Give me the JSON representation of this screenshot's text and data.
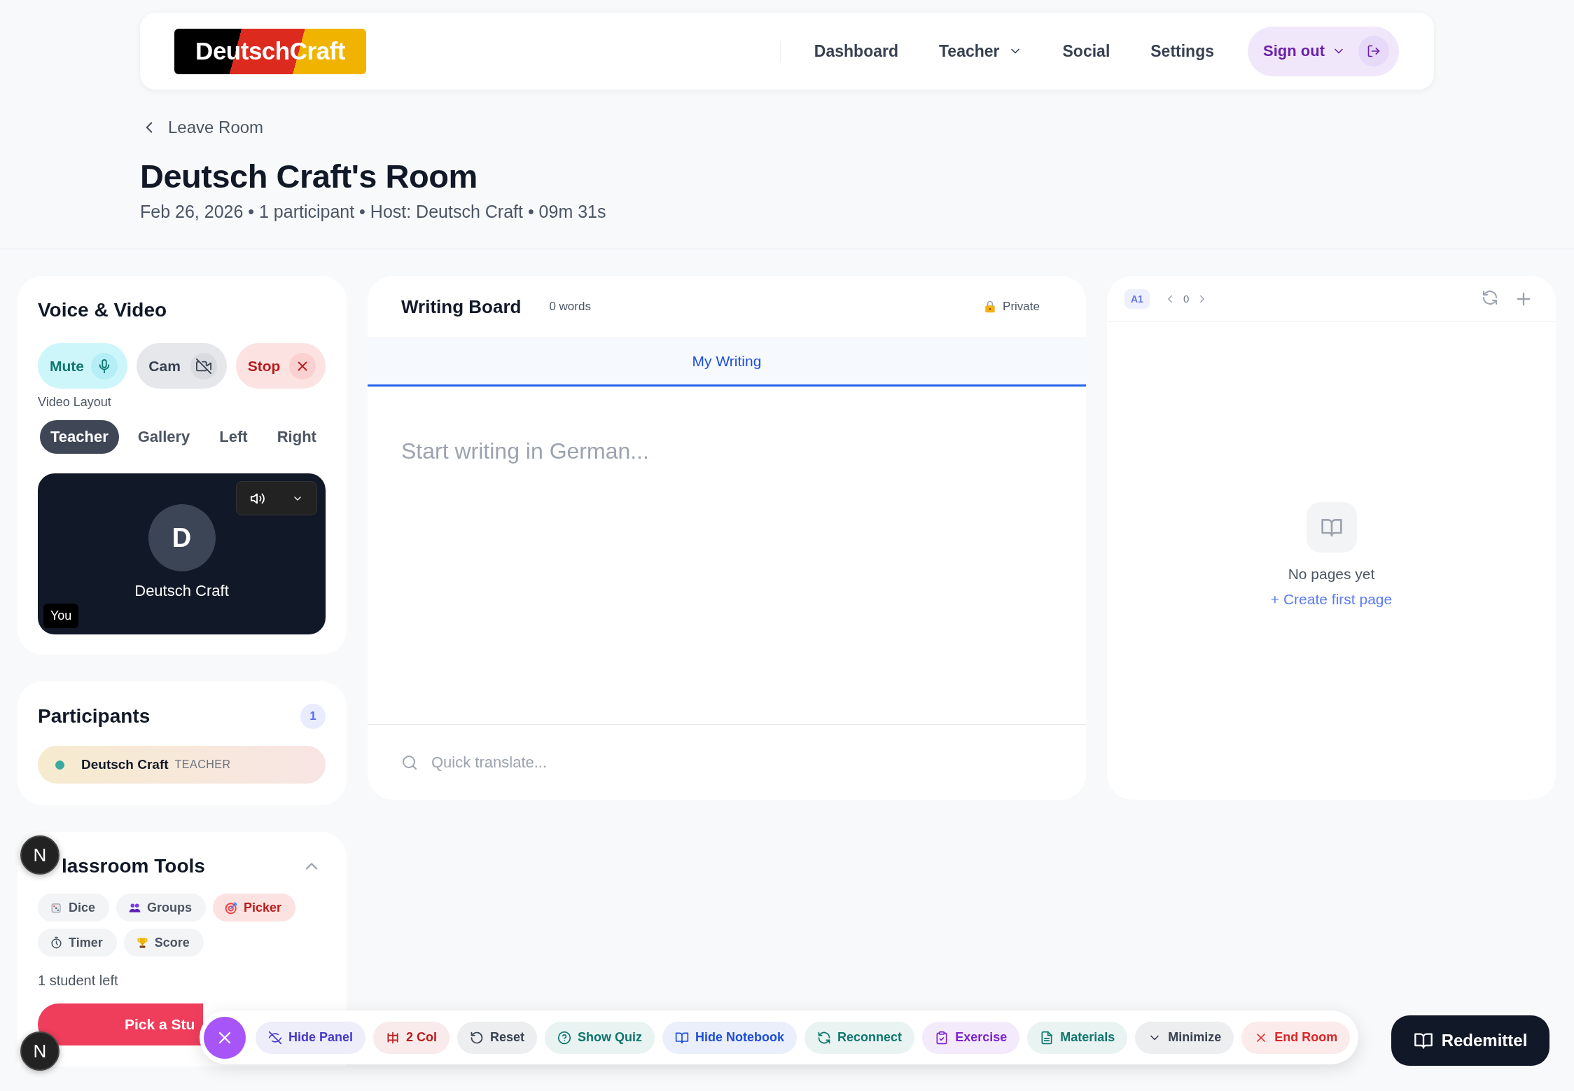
{
  "header": {
    "logo": "DeutschCraft",
    "nav": [
      {
        "label": "Dashboard",
        "dropdown": false
      },
      {
        "label": "Teacher",
        "dropdown": true
      },
      {
        "label": "Social",
        "dropdown": false
      },
      {
        "label": "Settings",
        "dropdown": false
      }
    ],
    "account": {
      "label": "Sign out"
    }
  },
  "room": {
    "back": "Leave Room",
    "title": "Deutsch Craft's Room",
    "meta": "Feb 26, 2026 • 1 participant • Host: Deutsch Craft • 09m 31s"
  },
  "voice_video": {
    "title": "Voice & Video",
    "controls": [
      {
        "kind": "mic",
        "label": "Mute",
        "color": "#0f766e"
      },
      {
        "kind": "camoff",
        "label": "Cam",
        "color": "#374151"
      },
      {
        "kind": "stop",
        "label": "Stop",
        "color": "#b91c1c"
      }
    ],
    "layout_label": "Video Layout",
    "layouts": [
      {
        "label": "Teacher",
        "selected": true
      },
      {
        "label": "Gallery",
        "selected": false
      },
      {
        "label": "Left",
        "selected": false
      },
      {
        "label": "Right",
        "selected": false
      }
    ],
    "tile": {
      "initial": "D",
      "name": "Deutsch Craft",
      "tag": "You"
    }
  },
  "participants": {
    "title": "Participants",
    "count": "1",
    "items": [
      {
        "name": "Deutsch Craft",
        "role": "TEACHER",
        "color": "#3aa99f"
      }
    ]
  },
  "classroom_tools": {
    "title": "lassroom Tools",
    "expanded": true,
    "tools": [
      {
        "label": "Dice",
        "selected": false
      },
      {
        "label": "Groups",
        "selected": false
      },
      {
        "label": "Picker",
        "selected": true
      },
      {
        "label": "Timer",
        "selected": false
      },
      {
        "label": "Score",
        "selected": false
      }
    ],
    "status": "1 student left",
    "action": "Pick a Stu"
  },
  "writing_board": {
    "title": "Writing Board",
    "word_count": "0 words",
    "visibility": "Private",
    "tabs": [
      {
        "label": "My Writing",
        "selected": true
      }
    ],
    "placeholder": "Start writing in German...",
    "translate_placeholder": "Quick translate..."
  },
  "notebook": {
    "level_badge": "A1",
    "page": "0",
    "empty_text": "No pages yet",
    "create_link": "+ Create first page"
  },
  "dock": {
    "items": [
      {
        "label": "Hide Panel",
        "color": "#4338ca"
      },
      {
        "label": "2 Col",
        "color": "#b91c1c"
      },
      {
        "label": "Reset",
        "color": "#374151"
      },
      {
        "label": "Show Quiz",
        "color": "#0f766e"
      },
      {
        "label": "Hide Notebook",
        "color": "#1d4ed8"
      },
      {
        "label": "Reconnect",
        "color": "#0f766e"
      },
      {
        "label": "Exercise",
        "color": "#7e22ce"
      },
      {
        "label": "Materials",
        "color": "#0f766e"
      },
      {
        "label": "Minimize",
        "color": "#374151"
      },
      {
        "label": "End Room",
        "color": "#dc2626"
      }
    ]
  },
  "redemittel": {
    "label": "Redemittel"
  },
  "dev_badges": [
    "N",
    "N"
  ]
}
